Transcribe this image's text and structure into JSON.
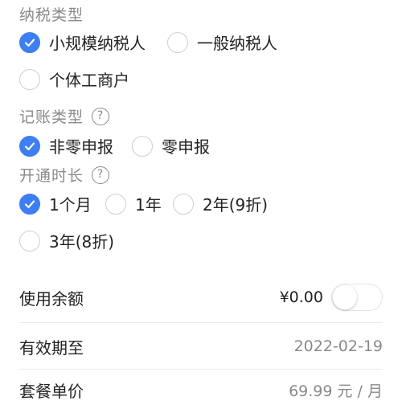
{
  "tax_type": {
    "title": "纳税类型",
    "options": [
      {
        "label": "小规模纳税人",
        "checked": true
      },
      {
        "label": "一般纳税人",
        "checked": false
      },
      {
        "label": "个体工商户",
        "checked": false
      }
    ]
  },
  "accounting_type": {
    "title": "记账类型",
    "help_icon": "question-circle-icon",
    "help_glyph": "?",
    "options": [
      {
        "label": "非零申报",
        "checked": true
      },
      {
        "label": "零申报",
        "checked": false
      }
    ]
  },
  "duration": {
    "title": "开通时长",
    "help_icon": "question-circle-icon",
    "help_glyph": "?",
    "options": [
      {
        "label": "1个月",
        "checked": true
      },
      {
        "label": "1年",
        "checked": false
      },
      {
        "label": "2年(9折)",
        "checked": false
      },
      {
        "label": "3年(8折)",
        "checked": false
      }
    ]
  },
  "balance": {
    "label": "使用余额",
    "amount": "¥0.00",
    "toggle_on": false
  },
  "expiry": {
    "label": "有效期至",
    "value": "2022-02-19"
  },
  "unit_price": {
    "label": "套餐单价",
    "value": "69.99 元 / 月"
  },
  "colors": {
    "accent": "#3d7ef0",
    "muted": "#8a8a8a",
    "text": "#222222"
  }
}
